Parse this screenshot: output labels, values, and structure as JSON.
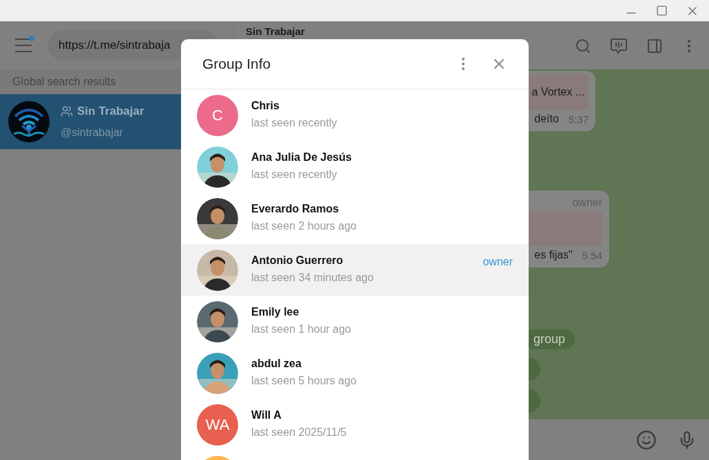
{
  "sidebar": {
    "search": {
      "value": "https://t.me/sintrabaja"
    },
    "section_title": "Global search results",
    "results": [
      {
        "title": "Sin Trabajar",
        "subtitle": "@sintrabajar",
        "selected": true
      }
    ]
  },
  "chat": {
    "title": "Sin Trabajar",
    "messages": [
      {
        "kind": "bubble",
        "reply": "a Vortex ...",
        "text": "deíto",
        "time": "5:37"
      },
      {
        "kind": "bubble",
        "author_badge": "owner",
        "text": "es fijas\"",
        "time": "5:54"
      },
      {
        "kind": "service",
        "text": "group"
      },
      {
        "kind": "round"
      },
      {
        "kind": "round"
      }
    ]
  },
  "dialog": {
    "title": "Group Info",
    "members": [
      {
        "kind": "initials",
        "initials": "C",
        "color": "#ec6b8c",
        "name": "Chris",
        "status": "last seen recently",
        "selected": false
      },
      {
        "name": "Ana Julia De Jesús",
        "status": "last seen recently",
        "selected": false
      },
      {
        "name": "Everardo Ramos",
        "status": "last seen 2 hours ago",
        "selected": false
      },
      {
        "name": "Antonio Guerrero",
        "status": "last seen 34 minutes ago",
        "badge": "owner",
        "selected": true
      },
      {
        "name": "Emily lee",
        "status": "last seen 1 hour ago",
        "selected": false
      },
      {
        "name": "abdul zea",
        "status": "last seen 5 hours ago",
        "selected": false
      },
      {
        "kind": "initials",
        "initials": "WA",
        "color": "#e8604f",
        "name": "Will A",
        "status": "last seen 2025/11/5",
        "selected": false
      },
      {
        "kind": "initials",
        "color": "#ffb656",
        "selected": false
      }
    ]
  }
}
